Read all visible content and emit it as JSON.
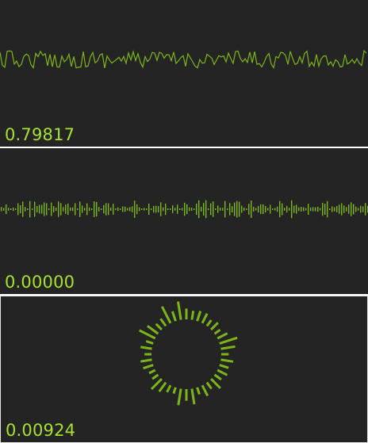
{
  "colors": {
    "background": "#242424",
    "accent": "#a6e22e",
    "waveform_stroke": "#7cb518",
    "bar_fill": "#7cb518",
    "separator": "#ffffff"
  },
  "panels": [
    {
      "kind": "waveform",
      "readout": "0.79817"
    },
    {
      "kind": "frequency-bars",
      "readout": "0.00000"
    },
    {
      "kind": "radial-bars",
      "readout": "0.00924"
    }
  ]
}
